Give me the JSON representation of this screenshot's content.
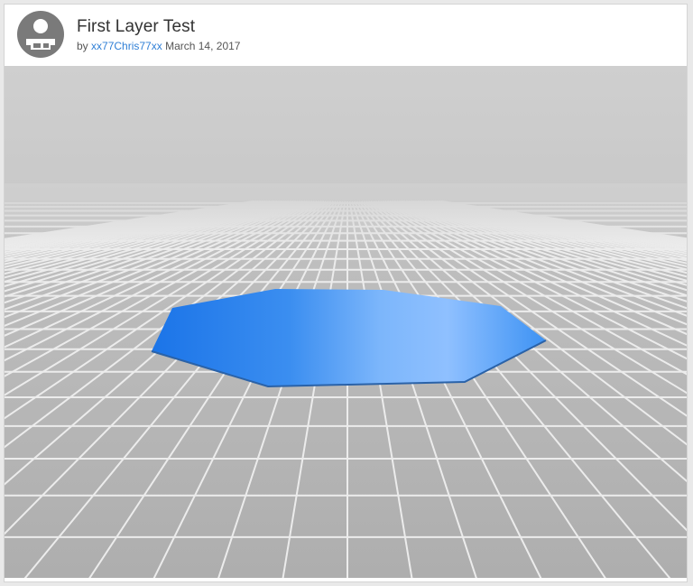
{
  "post": {
    "title": "First Layer Test",
    "by_label": "by",
    "author": "xx77Chris77xx",
    "date": "March 14, 2017"
  },
  "viewer": {
    "model_shape": "octagon",
    "model_color": "#3b8ef0",
    "background_top": "#c9c9c9",
    "floor_color": "#b3b3b3",
    "grid_line_color": "#ececec"
  },
  "icons": {
    "avatar": "user-avatar-icon"
  }
}
